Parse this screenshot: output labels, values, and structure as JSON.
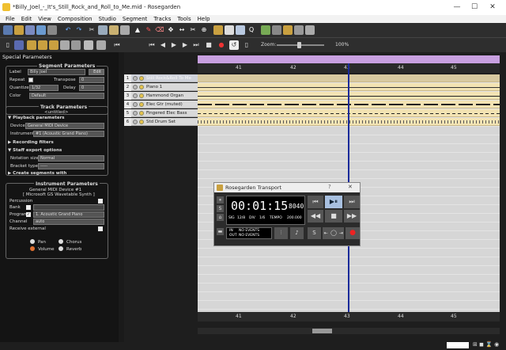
{
  "window": {
    "title": "*Billy_Joel_-_It's_Still_Rock_and_Roll_to_Me.mid - Rosegarden"
  },
  "menu": [
    "File",
    "Edit",
    "View",
    "Composition",
    "Studio",
    "Segment",
    "Tracks",
    "Tools",
    "Help"
  ],
  "toolbar2": {
    "zoom_label": "Zoom:",
    "zoom_value": "100%"
  },
  "left_panel": {
    "title": "Special Parameters",
    "segment": {
      "header": "Segment Parameters",
      "label_label": "Label",
      "label_value": "Billy Joel",
      "edit_button": "Edit",
      "repeat_label": "Repeat",
      "transpose_label": "Transpose",
      "transpose_value": "0",
      "quantize_label": "Quantize",
      "quantize_value": "1/32",
      "delay_label": "Delay",
      "delay_value": "0",
      "color_label": "Color",
      "color_value": "Default"
    },
    "track": {
      "header": "Track Parameters",
      "subtitle": "<untitled>",
      "playback_header": "Playback parameters",
      "device_label": "Device",
      "device_value": "General MIDI Device",
      "instrument_label": "Instrument",
      "instrument_value": "#1 (Acoustic Grand Piano)",
      "recording_header": "Recording filters",
      "staff_header": "Staff export options",
      "notation_label": "Notation size:",
      "notation_value": "Normal",
      "bracket_label": "Bracket type:",
      "bracket_value": "-----",
      "create_header": "Create segments with"
    },
    "instrument": {
      "header": "Instrument Parameters",
      "line1": "General MIDI Device  #1",
      "line2": "[ Microsoft GS Wavetable Synth ]",
      "percussion_label": "Percussion",
      "bank_label": "Bank",
      "program_label": "Program",
      "program_value": "1. Acoustic Grand Piano",
      "channel_label": "Channel",
      "channel_value": "auto",
      "receive_label": "Receive external",
      "knobs": [
        "Pan",
        "Chorus",
        "Volume",
        "Reverb"
      ]
    }
  },
  "tracks": [
    {
      "num": "1",
      "name": "Still Rock&Roll To Me"
    },
    {
      "num": "2",
      "name": "Piano 1"
    },
    {
      "num": "3",
      "name": "Hammond Organ"
    },
    {
      "num": "4",
      "name": "Elec Gtr (muted)"
    },
    {
      "num": "5",
      "name": "Fingered Elec Bass"
    },
    {
      "num": "6",
      "name": "Std Drum Set"
    }
  ],
  "ruler": {
    "bars": [
      "41",
      "42",
      "43",
      "44",
      "45"
    ]
  },
  "transport": {
    "title": "Rosegarden Transport",
    "time": "00:01:15",
    "time_frac": "8040",
    "sig_label": "SIG",
    "sig_value": "12/8",
    "div_label": "DIV",
    "div_value": "1/6",
    "tempo_label": "TEMPO",
    "tempo_value": "200.000",
    "in_label": "IN",
    "in_value": "NO EVENTS",
    "out_label": "OUT",
    "out_value": "NO EVENTS",
    "help_glyph": "?",
    "close_glyph": "✕"
  },
  "colors": {
    "accent_bar": "#c8a0e0",
    "playhead": "#1a2a9a",
    "segment": "#f3e3b3"
  }
}
